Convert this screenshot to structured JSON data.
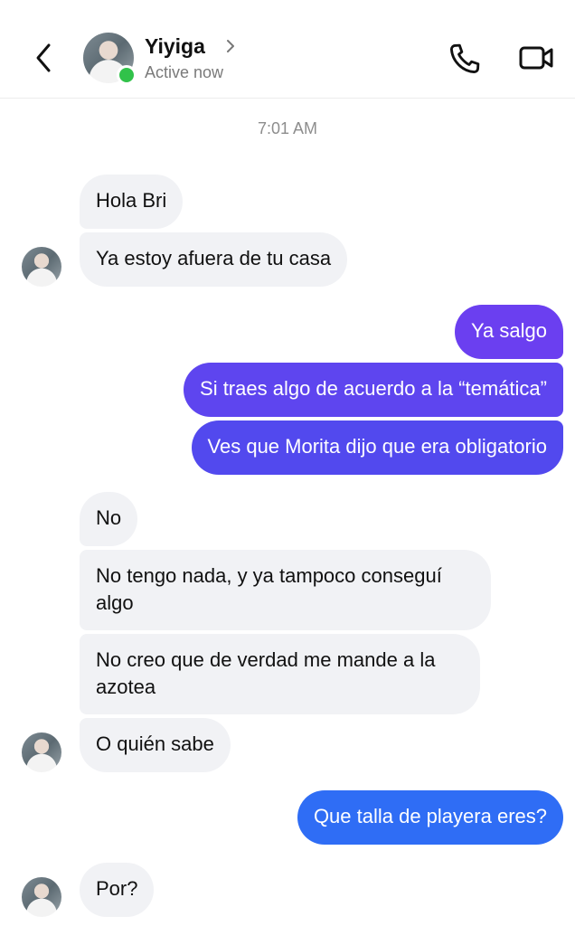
{
  "header": {
    "contact_name": "Yiyiga",
    "status": "Active now"
  },
  "conversation": {
    "timestamp": "7:01 AM",
    "messages": [
      {
        "text": "Hola Bri"
      },
      {
        "text": "Ya estoy afuera de tu casa"
      },
      {
        "text": "Ya salgo"
      },
      {
        "text": "Si traes algo de acuerdo a la “temática”"
      },
      {
        "text": "Ves que Morita dijo que era obligatorio"
      },
      {
        "text": "No"
      },
      {
        "text": "No tengo nada, y ya tampoco conseguí algo"
      },
      {
        "text": "No creo que de verdad me mande a la azotea"
      },
      {
        "text": "O quién sabe"
      },
      {
        "text": "Que talla de playera eres?"
      },
      {
        "text": "Por?"
      }
    ]
  },
  "colors": {
    "outgoing_purple": "#6b3ff0",
    "outgoing_blue": "#2f6df5",
    "incoming_bg": "#f1f2f5",
    "online": "#31c24a"
  }
}
